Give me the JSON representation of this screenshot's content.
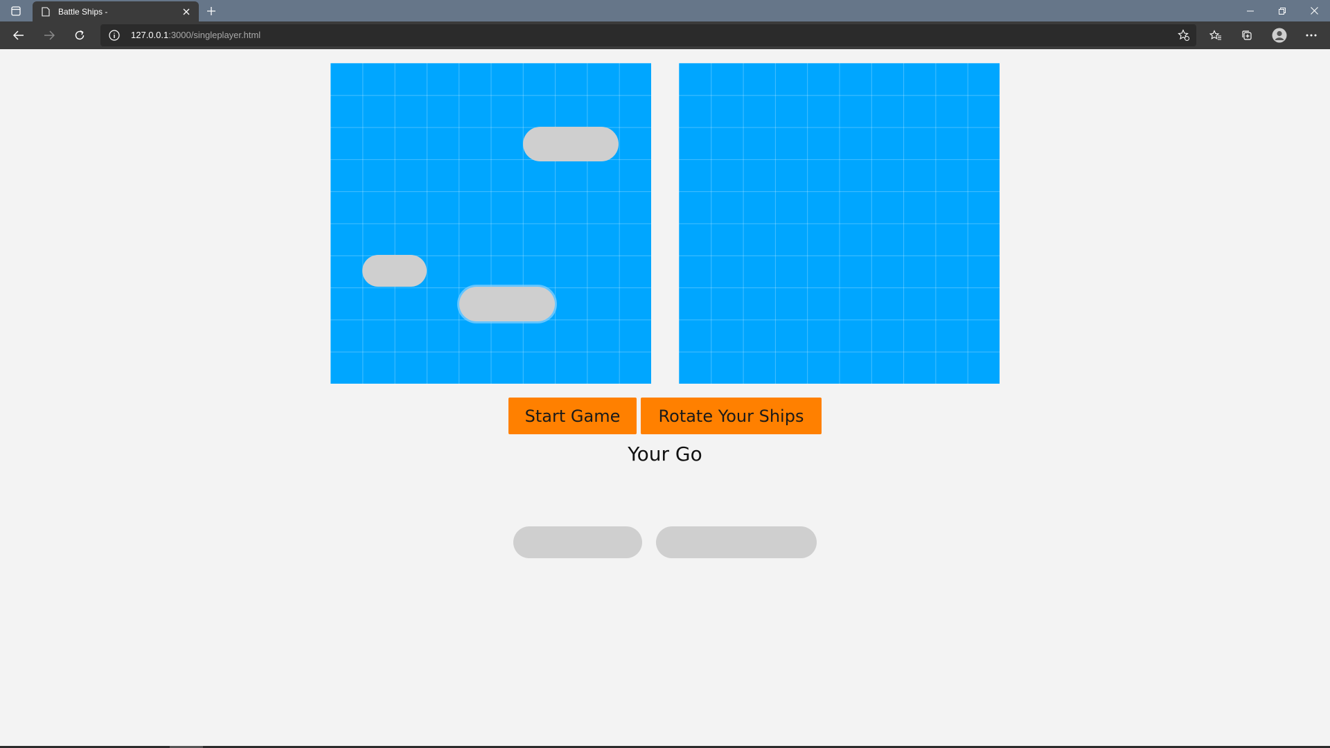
{
  "browser": {
    "tab_title": "Battle Ships -",
    "url_host": "127.0.0.1",
    "url_path": ":3000/singleplayer.html"
  },
  "game": {
    "buttons": {
      "start": "Start Game",
      "rotate": "Rotate Your Ships"
    },
    "turn_display": "Your Go",
    "grid_size": 10,
    "colors": {
      "water": "#00a6ff",
      "ship": "#cfcfcf",
      "button": "#ff8000",
      "background": "#f3f3f3"
    },
    "icons": [
      "tab-actions-icon",
      "page-icon",
      "close-icon",
      "plus-icon",
      "minimize-icon",
      "restore-icon",
      "back-icon",
      "forward-icon",
      "refresh-icon",
      "info-icon",
      "add-favorite-icon",
      "favorites-icon",
      "collections-icon",
      "profile-icon",
      "more-icon"
    ]
  }
}
